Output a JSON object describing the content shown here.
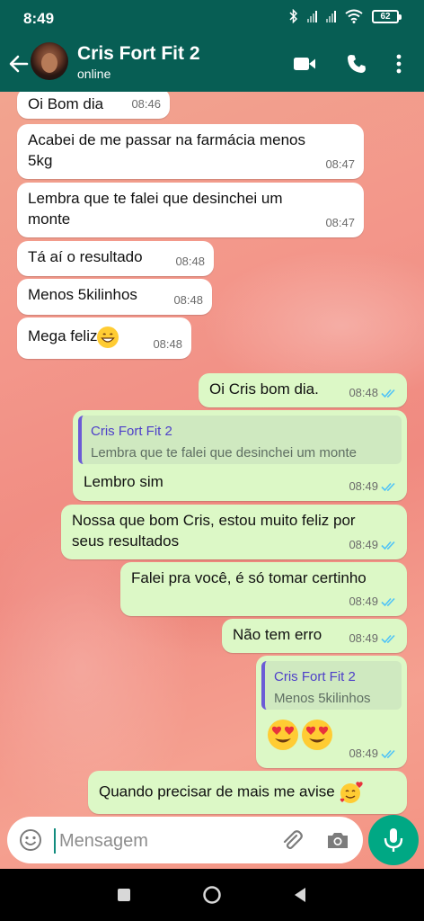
{
  "status_bar": {
    "time": "8:49",
    "battery": "62"
  },
  "header": {
    "contact_name": "Cris Fort Fit 2",
    "status": "online"
  },
  "messages": [
    {
      "dir": "in",
      "text": "Oi Bom dia",
      "time": "08:46"
    },
    {
      "dir": "in",
      "lines": [
        "Acabei de me passar na farmácia menos",
        "5kg"
      ],
      "time": "08:47"
    },
    {
      "dir": "in",
      "lines": [
        "Lembra que te falei que desinchei um",
        "monte"
      ],
      "time": "08:47"
    },
    {
      "dir": "in",
      "text": "Tá aí o resultado",
      "time": "08:48"
    },
    {
      "dir": "in",
      "text": "Menos 5kilinhos",
      "time": "08:48"
    },
    {
      "dir": "in",
      "text": "Mega feliz",
      "emoji": "grin",
      "time": "08:48"
    },
    {
      "dir": "out",
      "text": "Oi Cris bom dia.",
      "time": "08:48"
    },
    {
      "dir": "out",
      "quote_name": "Cris Fort Fit 2",
      "quote_text": "Lembra que te falei que desinchei um monte",
      "text": "Lembro sim",
      "time": "08:49"
    },
    {
      "dir": "out",
      "lines": [
        "Nossa que bom Cris, estou muito feliz por",
        "seus resultados"
      ],
      "time": "08:49"
    },
    {
      "dir": "out",
      "text": "Falei pra você, é só tomar certinho",
      "time": "08:49"
    },
    {
      "dir": "out",
      "text": "Não tem erro",
      "time": "08:49"
    },
    {
      "dir": "out",
      "quote_name": "Cris Fort Fit 2",
      "quote_text": "Menos 5kilinhos",
      "emoji_pair": "heart-eyes",
      "time": "08:49"
    },
    {
      "dir": "out",
      "text": "Quando precisar de mais me avise",
      "emoji": "smiling-face-with-hearts"
    }
  ],
  "composer": {
    "placeholder": "Mensagem"
  },
  "colors": {
    "header": "#075e54",
    "outgoing": "#dcf8c6",
    "incoming": "#ffffff",
    "read_ticks": "#4fc3f7",
    "mic_button": "#00a884"
  },
  "icons": [
    "back-arrow-icon",
    "video-call-icon",
    "phone-icon",
    "more-menu-icon",
    "emoji-icon",
    "attach-icon",
    "camera-icon",
    "mic-icon",
    "read-receipt-icon",
    "nav-back-icon",
    "nav-home-icon",
    "nav-recents-icon"
  ]
}
